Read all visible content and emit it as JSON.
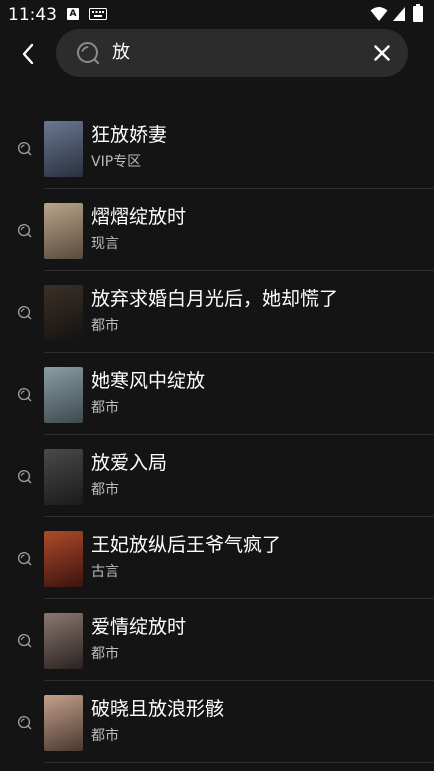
{
  "status_bar": {
    "time": "11:43",
    "notification_icon_letter": "A"
  },
  "search": {
    "query": "放"
  },
  "results": [
    {
      "title": "狂放娇妻",
      "tag": "VIP专区",
      "cover_colors": [
        "#6a7890",
        "#2a3040"
      ]
    },
    {
      "title": "熠熠绽放时",
      "tag": "现言",
      "cover_colors": [
        "#b8a58a",
        "#5a4a3c"
      ]
    },
    {
      "title": "放弃求婚白月光后，她却慌了",
      "tag": "都市",
      "cover_colors": [
        "#3a3028",
        "#151210"
      ]
    },
    {
      "title": "她寒风中绽放",
      "tag": "都市",
      "cover_colors": [
        "#8a9ea0",
        "#3c4a50"
      ]
    },
    {
      "title": "放爱入局",
      "tag": "都市",
      "cover_colors": [
        "#4a4a4a",
        "#1a1a1c"
      ]
    },
    {
      "title": "王妃放纵后王爷气疯了",
      "tag": "古言",
      "cover_colors": [
        "#b04a28",
        "#3a1410"
      ]
    },
    {
      "title": "爱情绽放时",
      "tag": "都市",
      "cover_colors": [
        "#8a7870",
        "#2a2220"
      ]
    },
    {
      "title": "破晓且放浪形骸",
      "tag": "都市",
      "cover_colors": [
        "#c4a08a",
        "#4a3830"
      ]
    }
  ]
}
